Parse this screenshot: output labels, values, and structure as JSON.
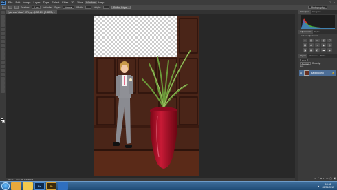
{
  "app": {
    "logo": "Ps",
    "menu": [
      "File",
      "Edit",
      "Image",
      "Layer",
      "Type",
      "Select",
      "Filter",
      "3D",
      "View",
      "Window",
      "Help"
    ],
    "active_menu": "Window",
    "window_controls": [
      "–",
      "□",
      "×"
    ]
  },
  "options_bar": {
    "feather_label": "Feather:",
    "feather_value": "0 px",
    "antialias_label": "Anti-alias",
    "style_label": "Style:",
    "style_value": "Normal",
    "width_label": "Width:",
    "height_label": "Height:",
    "refine_button": "Refine Edge...",
    "workspace": "Photography"
  },
  "document": {
    "tab_title": "'pic' and 'class' 074.jpg @ 33.1% (RGB/8)",
    "close_icon": "×"
  },
  "status": {
    "zoom": "33.1%",
    "doc_info": "Doc: 25.1M/25.1M"
  },
  "panels": {
    "histogram_tabs": [
      "Histogram",
      "Navigator"
    ],
    "adjustment_tabs": [
      "Adjustments",
      "Styles"
    ],
    "adjustment_title": "Add an adjustment",
    "layer_tabs": [
      "Layers",
      "Channels",
      "Paths"
    ],
    "kind_select": "Kind",
    "blend_mode": "Normal",
    "opacity_label": "Opacity:",
    "fill_label": "Fill:",
    "layer_name": "Background",
    "lock_icon": "lock-icon"
  },
  "taskbar": {
    "apps": [
      {
        "label": "",
        "bg": "#e8a93c"
      },
      {
        "label": "",
        "bg": "#f2c94c"
      },
      {
        "label": "Ps",
        "bg": "#0d2a4d"
      },
      {
        "label": "Br",
        "bg": "#3b2a0b"
      },
      {
        "label": "",
        "bg": "#2f6fbf"
      }
    ],
    "time": "13:56",
    "date": "05/06/2013"
  },
  "colors": {
    "accent_layer": "#4c6d96",
    "vase_red": "#b0102a"
  }
}
